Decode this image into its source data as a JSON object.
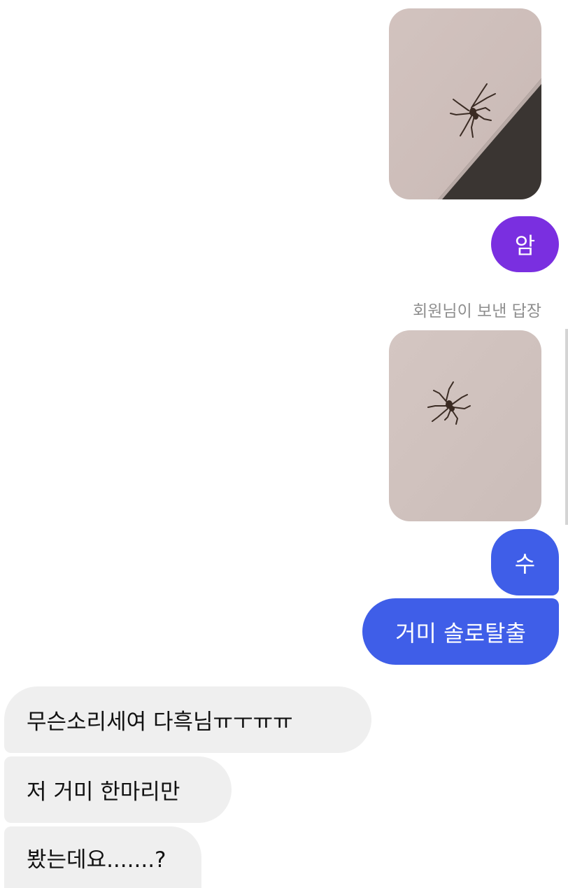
{
  "colors": {
    "purple": "#7a2fe0",
    "blue": "#3f5ee8",
    "received_bubble": "#efefef",
    "caption": "#8e8e8e"
  },
  "messages": [
    {
      "type": "image",
      "sender": "me",
      "content": "spider on wall photo 1"
    },
    {
      "type": "text",
      "sender": "me",
      "text": "암"
    },
    {
      "type": "reply_caption",
      "text": "회원님이 보낸 답장"
    },
    {
      "type": "image",
      "sender": "me",
      "content": "spider on wall photo 2"
    },
    {
      "type": "text",
      "sender": "me",
      "text": "수"
    },
    {
      "type": "text",
      "sender": "me",
      "text": "거미 솔로탈출"
    },
    {
      "type": "text",
      "sender": "other",
      "text": "무슨소리세여 다흑님ㅠㅜㅠㅠ"
    },
    {
      "type": "text",
      "sender": "other",
      "text": "저 거미 한마리만"
    },
    {
      "type": "text",
      "sender": "other",
      "text": "봤는데요.......?"
    }
  ]
}
